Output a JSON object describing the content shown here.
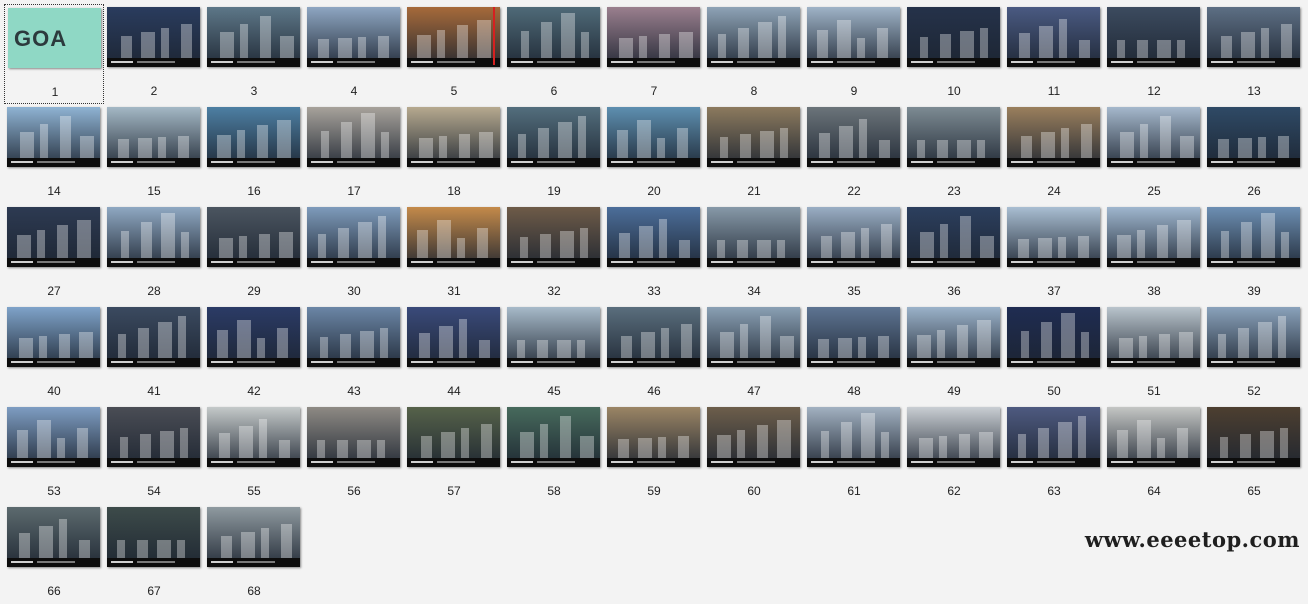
{
  "window": {
    "title": ""
  },
  "slides": [
    {
      "n": "1",
      "palette": "#8fd8c5",
      "logo": "GOA",
      "selected": true
    },
    {
      "n": "2",
      "palette": "#2a3c5e"
    },
    {
      "n": "3",
      "palette": "#5d7788"
    },
    {
      "n": "4",
      "palette": "#8ea6c2"
    },
    {
      "n": "5",
      "palette": "#a66a3a"
    },
    {
      "n": "6",
      "palette": "#4f6a78"
    },
    {
      "n": "7",
      "palette": "#9a7f8e"
    },
    {
      "n": "8",
      "palette": "#8ea3b6"
    },
    {
      "n": "9",
      "palette": "#9fb3c7"
    },
    {
      "n": "10",
      "palette": "#25324a"
    },
    {
      "n": "11",
      "palette": "#4a5a82"
    },
    {
      "n": "12",
      "palette": "#3c4b5f"
    },
    {
      "n": "13",
      "palette": "#5d6f84"
    },
    {
      "n": "14",
      "palette": "#8fb3d3"
    },
    {
      "n": "15",
      "palette": "#a4b8c5"
    },
    {
      "n": "16",
      "palette": "#4d7fa3"
    },
    {
      "n": "17",
      "palette": "#a7a29b"
    },
    {
      "n": "18",
      "palette": "#b6a98f"
    },
    {
      "n": "19",
      "palette": "#536e7d"
    },
    {
      "n": "20",
      "palette": "#5e8fb0"
    },
    {
      "n": "21",
      "palette": "#8c7a5e"
    },
    {
      "n": "22",
      "palette": "#6b747a"
    },
    {
      "n": "23",
      "palette": "#7d8b93"
    },
    {
      "n": "24",
      "palette": "#9a7f5d"
    },
    {
      "n": "25",
      "palette": "#a5b8cc"
    },
    {
      "n": "26",
      "palette": "#2f4a66"
    },
    {
      "n": "27",
      "palette": "#2d3a52"
    },
    {
      "n": "28",
      "palette": "#8fa8c2"
    },
    {
      "n": "29",
      "palette": "#4b5560"
    },
    {
      "n": "30",
      "palette": "#7e9bbb"
    },
    {
      "n": "31",
      "palette": "#c48a4a"
    },
    {
      "n": "32",
      "palette": "#6e5b48"
    },
    {
      "n": "33",
      "palette": "#4c6e9a"
    },
    {
      "n": "34",
      "palette": "#8799a8"
    },
    {
      "n": "35",
      "palette": "#9aaec4"
    },
    {
      "n": "36",
      "palette": "#2c3f5e"
    },
    {
      "n": "37",
      "palette": "#a9bed2"
    },
    {
      "n": "38",
      "palette": "#9fb6ce"
    },
    {
      "n": "39",
      "palette": "#6d8fb3"
    },
    {
      "n": "40",
      "palette": "#7fa3c9"
    },
    {
      "n": "41",
      "palette": "#3b4a60"
    },
    {
      "n": "42",
      "palette": "#2b3b66"
    },
    {
      "n": "43",
      "palette": "#6b86a6"
    },
    {
      "n": "44",
      "palette": "#3a4a7a"
    },
    {
      "n": "45",
      "palette": "#a7bac9"
    },
    {
      "n": "46",
      "palette": "#5a6e7d"
    },
    {
      "n": "47",
      "palette": "#8aa0b4"
    },
    {
      "n": "48",
      "palette": "#5e7492"
    },
    {
      "n": "49",
      "palette": "#9bb2c9"
    },
    {
      "n": "50",
      "palette": "#1f2c52"
    },
    {
      "n": "51",
      "palette": "#b9c4cc"
    },
    {
      "n": "52",
      "palette": "#8aa2bb"
    },
    {
      "n": "53",
      "palette": "#7e9dc2"
    },
    {
      "n": "54",
      "palette": "#4a4d55"
    },
    {
      "n": "55",
      "palette": "#c4c9c9"
    },
    {
      "n": "56",
      "palette": "#8e8a84"
    },
    {
      "n": "57",
      "palette": "#56624a"
    },
    {
      "n": "58",
      "palette": "#476a5c"
    },
    {
      "n": "59",
      "palette": "#9b8565"
    },
    {
      "n": "60",
      "palette": "#6d5e4b"
    },
    {
      "n": "61",
      "palette": "#a2b1c1"
    },
    {
      "n": "62",
      "palette": "#c9ced3"
    },
    {
      "n": "63",
      "palette": "#4e5a80"
    },
    {
      "n": "64",
      "palette": "#c4c6c4"
    },
    {
      "n": "65",
      "palette": "#4d3f30"
    },
    {
      "n": "66",
      "palette": "#5c6a6e"
    },
    {
      "n": "67",
      "palette": "#3d4b4a"
    },
    {
      "n": "68",
      "palette": "#8f9aa0"
    }
  ],
  "watermark": "www.eeeetop.com"
}
